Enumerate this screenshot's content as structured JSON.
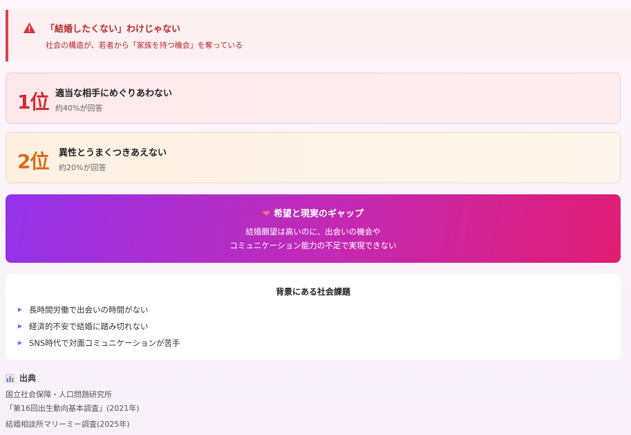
{
  "alert": {
    "icon": "warning-triangle-icon",
    "title": "「結婚したくない」わけじゃない",
    "subtitle": "社会の構造が、若者から「家族を持つ機会」を奪っている"
  },
  "ranks": [
    {
      "rank": "1位",
      "label": "適当な相手にめぐりあわない",
      "note": "約40%が回答",
      "color": "#d62a36"
    },
    {
      "rank": "2位",
      "label": "異性とうまくつきあえない",
      "note": "約20%が回答",
      "color": "#e06a10"
    }
  ],
  "gap": {
    "icon": "broken-heart-icon",
    "title": "希望と現実のギャップ",
    "line1": "結婚願望は高いのに、出会いの機会や",
    "line2": "コミュニケーション能力の不足で実現できない"
  },
  "issues": {
    "title": "背景にある社会課題",
    "items": [
      "長時間労働で出会いの時間がない",
      "経済的不安で結婚に踏み切れない",
      "SNS時代で対面コミュニケーションが苦手"
    ]
  },
  "sources": {
    "icon": "bar-chart-icon",
    "title": "出典",
    "line1": "国立社会保障・人口問題研究所",
    "line2": "「第16回出生動向基本調査」(2021年)",
    "line3": "結婚相談所マリーミー調査(2025年)"
  }
}
